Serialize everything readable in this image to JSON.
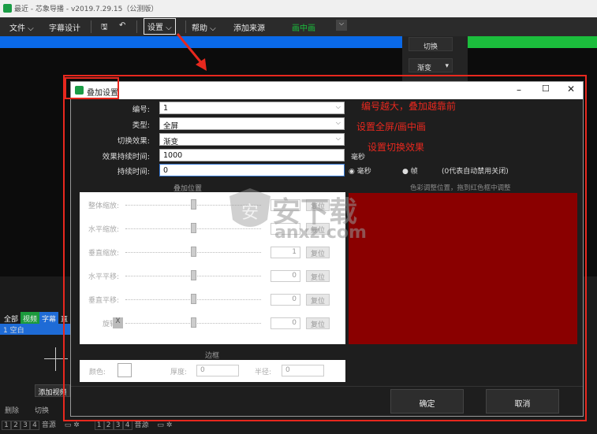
{
  "app": {
    "title": "最近 - 芯象导播 - v2019.7.29.15（公测版）"
  },
  "menu": {
    "file": "文件",
    "subtitle": "字幕设计",
    "settings": "设置",
    "help": "帮助",
    "add_source": "添加来源",
    "pip": "画中画"
  },
  "side": {
    "switch": "切换",
    "fade": "渐变"
  },
  "bottom": {
    "tabs": [
      "全部",
      "视频",
      "字幕",
      "直"
    ],
    "item": "1 空白",
    "add_video": "添加视频",
    "delete": "删除",
    "switch": "切换",
    "pages": [
      "1",
      "2",
      "3",
      "4"
    ],
    "pages2": [
      "1",
      "2",
      "3",
      "4"
    ],
    "screen": "音源"
  },
  "dialog": {
    "title": "叠加设置",
    "fields": {
      "number_label": "编号:",
      "number": "1",
      "type_label": "类型:",
      "type": "全屏",
      "effect_label": "切换效果:",
      "effect": "渐变",
      "effect_dur_label": "效果持续时间:",
      "effect_dur": "1000",
      "dur_label": "持续时间:",
      "dur": "0"
    },
    "unit_ms": "毫秒",
    "radio_ms": "毫秒",
    "radio_frame": "帧",
    "zero_note": "(0代表自动禁用关闭)",
    "left_header": "叠加位置",
    "right_header": "色彩调整位置，拖到红色框中调整",
    "sliders": [
      {
        "label": "整体缩放:",
        "value": "",
        "reset": "复位"
      },
      {
        "label": "水平缩放:",
        "value": "",
        "reset": "复位"
      },
      {
        "label": "垂直缩放:",
        "value": "1",
        "reset": "复位"
      },
      {
        "label": "水平平移:",
        "value": "0",
        "reset": "复位"
      },
      {
        "label": "垂直平移:",
        "value": "0",
        "reset": "复位"
      },
      {
        "label": "旋转:",
        "value": "0",
        "reset": "复位"
      }
    ],
    "rotate_x": "X",
    "border_header": "边框",
    "color_label": "颜色:",
    "thickness_label": "厚度:",
    "thickness": "0",
    "radius_label": "半径:",
    "radius": "0",
    "ok": "确定",
    "cancel": "取消"
  },
  "annotations": {
    "a1": "编号越大，叠加越靠前",
    "a2": "设置全屏/画中画",
    "a3": "设置切换效果"
  },
  "watermark": {
    "cn": "安下载",
    "en": "anxz.com"
  },
  "colors": {
    "annotation": "#e8281e",
    "preview": "#8a0000",
    "blue": "#0a69e8",
    "green": "#1bbe3c"
  }
}
